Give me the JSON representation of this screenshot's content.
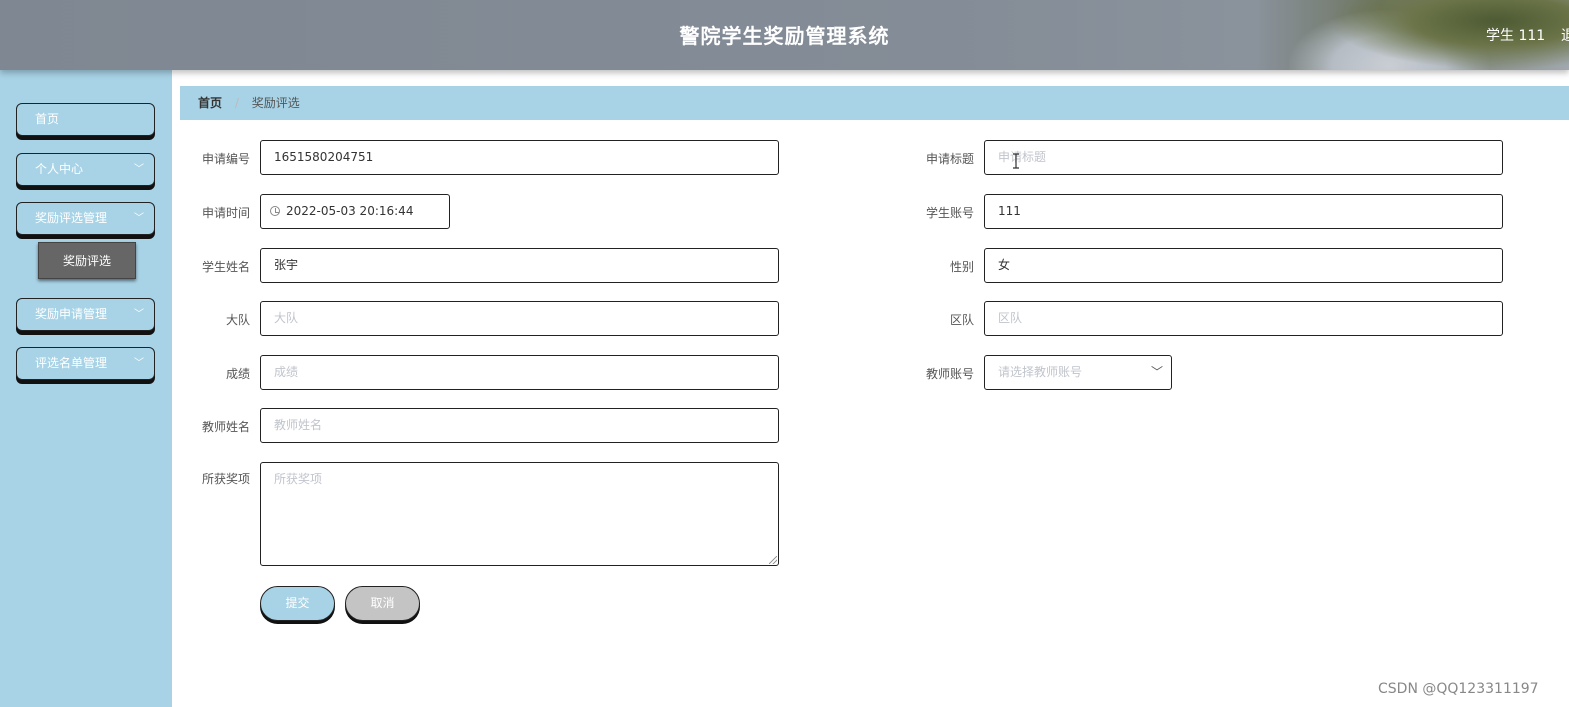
{
  "header": {
    "title": "警院学生奖励管理系统",
    "user_label": "学生 111",
    "logout_label": "退"
  },
  "sidebar": {
    "items": [
      {
        "label": "首页"
      },
      {
        "label": "个人中心"
      },
      {
        "label": "奖励评选管理"
      },
      {
        "label": "奖励申请管理"
      },
      {
        "label": "评选名单管理"
      }
    ],
    "active_sub_item": "奖励评选"
  },
  "breadcrumb": {
    "home": "首页",
    "separator": "/",
    "current": "奖励评选"
  },
  "form": {
    "application_no": {
      "label": "申请编号",
      "value": "1651580204751"
    },
    "application_title": {
      "label": "申请标题",
      "placeholder": "申请标题"
    },
    "application_time": {
      "label": "申请时间",
      "value": "2022-05-03 20:16:44"
    },
    "student_account": {
      "label": "学生账号",
      "value": "111"
    },
    "student_name": {
      "label": "学生姓名",
      "value": "张宇"
    },
    "gender": {
      "label": "性别",
      "value": "女"
    },
    "brigade": {
      "label": "大队",
      "placeholder": "大队"
    },
    "district_team": {
      "label": "区队",
      "placeholder": "区队"
    },
    "score": {
      "label": "成绩",
      "placeholder": "成绩"
    },
    "teacher_account": {
      "label": "教师账号",
      "placeholder": "请选择教师账号"
    },
    "teacher_name": {
      "label": "教师姓名",
      "placeholder": "教师姓名"
    },
    "awards": {
      "label": "所获奖项",
      "placeholder": "所获奖项"
    },
    "submit_label": "提交",
    "cancel_label": "取消"
  },
  "watermark": "CSDN @QQ123311197",
  "icons": {
    "chevron": "chevron-down-icon",
    "clock": "clock-icon",
    "text_cursor": "text-cursor-icon"
  },
  "colors": {
    "accent": "#a8d3e6",
    "header_bg": "#848c97",
    "submenu_bg": "#666666",
    "cancel_bg": "#c4c4c4"
  }
}
